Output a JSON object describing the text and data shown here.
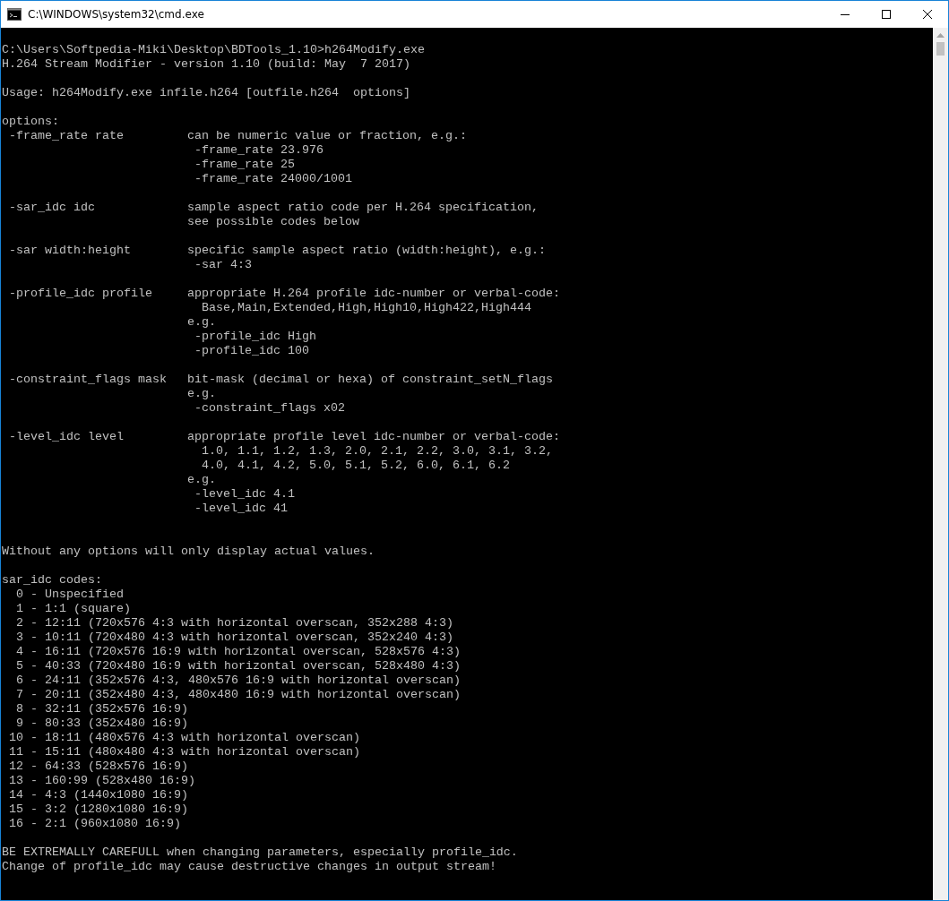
{
  "window": {
    "title": "C:\\WINDOWS\\system32\\cmd.exe"
  },
  "console": {
    "blocks": [
      {
        "lines": [
          "C:\\Users\\Softpedia-Miki\\Desktop\\BDTools_1.10>h264Modify.exe",
          "H.264 Stream Modifier - version 1.10 (build: May  7 2017)"
        ]
      },
      {
        "lines": [
          "Usage: h264Modify.exe infile.h264 [outfile.h264  options]"
        ]
      },
      {
        "lines": [
          "options:"
        ],
        "options": [
          {
            "option": "-frame_rate rate",
            "description": [
              "can be numeric value or fraction, e.g.:",
              " -frame_rate 23.976",
              " -frame_rate 25",
              " -frame_rate 24000/1001"
            ]
          },
          {
            "option": "-sar_idc idc",
            "description": [
              "sample aspect ratio code per H.264 specification,",
              "see possible codes below"
            ]
          },
          {
            "option": "-sar width:height",
            "description": [
              "specific sample aspect ratio (width:height), e.g.:",
              " -sar 4:3"
            ]
          },
          {
            "option": "-profile_idc profile",
            "description": [
              "appropriate H.264 profile idc-number or verbal-code:",
              "  Base,Main,Extended,High,High10,High422,High444",
              "e.g.",
              " -profile_idc High",
              " -profile_idc 100"
            ]
          },
          {
            "option": "-constraint_flags mask",
            "description": [
              "bit-mask (decimal or hexa) of constraint_setN_flags",
              "e.g.",
              " -constraint_flags x02"
            ]
          },
          {
            "option": "-level_idc level",
            "description": [
              "appropriate profile level idc-number or verbal-code:",
              "  1.0, 1.1, 1.2, 1.3, 2.0, 2.1, 2.2, 3.0, 3.1, 3.2,",
              "  4.0, 4.1, 4.2, 5.0, 5.1, 5.2, 6.0, 6.1, 6.2",
              "e.g.",
              " -level_idc 4.1",
              " -level_idc 41"
            ]
          }
        ]
      },
      {
        "lines": [
          "Without any options will only display actual values."
        ]
      },
      {
        "lines": [
          "sar_idc codes:",
          "  0 - Unspecified",
          "  1 - 1:1 (square)",
          "  2 - 12:11 (720x576 4:3 with horizontal overscan, 352x288 4:3)",
          "  3 - 10:11 (720x480 4:3 with horizontal overscan, 352x240 4:3)",
          "  4 - 16:11 (720x576 16:9 with horizontal overscan, 528x576 4:3)",
          "  5 - 40:33 (720x480 16:9 with horizontal overscan, 528x480 4:3)",
          "  6 - 24:11 (352x576 4:3, 480x576 16:9 with horizontal overscan)",
          "  7 - 20:11 (352x480 4:3, 480x480 16:9 with horizontal overscan)",
          "  8 - 32:11 (352x576 16:9)",
          "  9 - 80:33 (352x480 16:9)",
          " 10 - 18:11 (480x576 4:3 with horizontal overscan)",
          " 11 - 15:11 (480x480 4:3 with horizontal overscan)",
          " 12 - 64:33 (528x576 16:9)",
          " 13 - 160:99 (528x480 16:9)",
          " 14 - 4:3 (1440x1080 16:9)",
          " 15 - 3:2 (1280x1080 16:9)",
          " 16 - 2:1 (960x1080 16:9)"
        ]
      },
      {
        "lines": [
          "BE EXTREMALLY CAREFULL when changing parameters, especially profile_idc.",
          "Change of profile_idc may cause destructive changes in output stream!"
        ]
      }
    ]
  }
}
